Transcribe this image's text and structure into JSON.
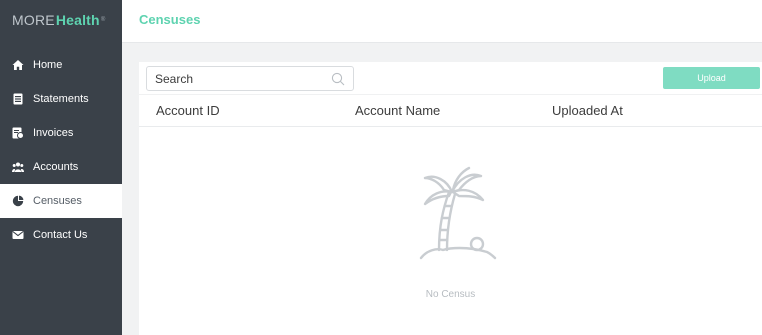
{
  "brand": {
    "part1": "MORE",
    "part2": "Health",
    "reg": "®"
  },
  "sidebar": {
    "items": [
      {
        "label": "Home",
        "icon": "home-icon"
      },
      {
        "label": "Statements",
        "icon": "statements-icon"
      },
      {
        "label": "Invoices",
        "icon": "invoices-icon"
      },
      {
        "label": "Accounts",
        "icon": "accounts-icon"
      },
      {
        "label": "Censuses",
        "icon": "pie-chart-icon",
        "active": true
      },
      {
        "label": "Contact Us",
        "icon": "envelope-icon"
      }
    ]
  },
  "header": {
    "title": "Censuses"
  },
  "toolbar": {
    "search_placeholder": "Search",
    "upload_label": "Upload"
  },
  "table": {
    "columns": [
      "Account ID",
      "Account Name",
      "Uploaded At"
    ],
    "rows": []
  },
  "empty_state": {
    "text": "No Census"
  },
  "colors": {
    "accent": "#5ed3b0",
    "button": "#7fdcc2",
    "sidebar_bg": "#3a4149"
  }
}
